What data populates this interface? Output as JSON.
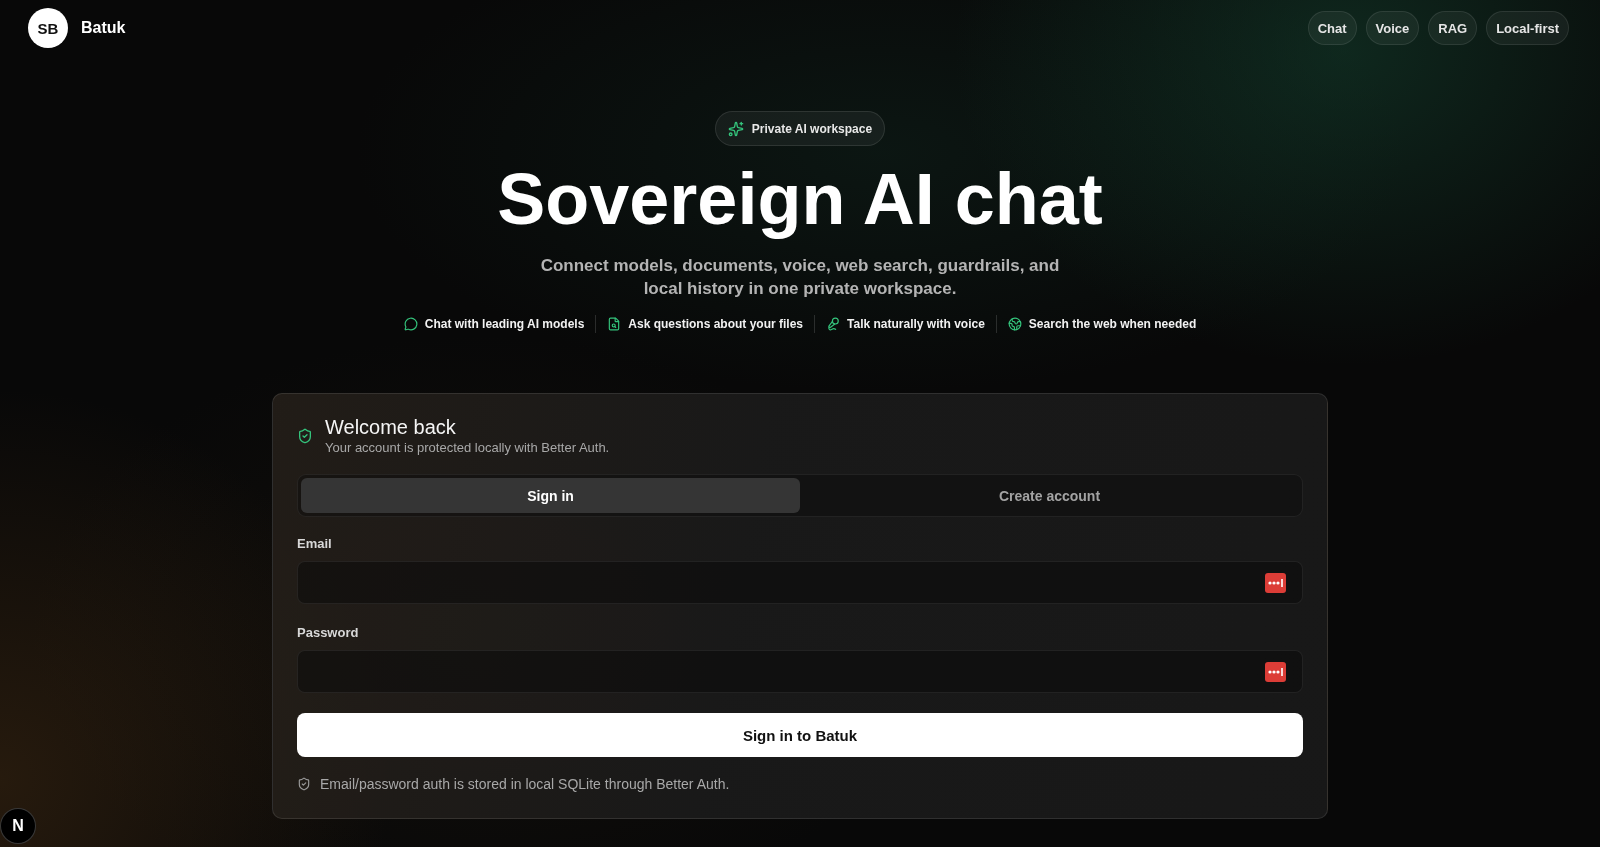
{
  "header": {
    "avatar": "SB",
    "brand": "Batuk",
    "tags": [
      "Chat",
      "Voice",
      "RAG",
      "Local-first"
    ]
  },
  "hero": {
    "badge": "Private AI workspace",
    "title": "Sovereign AI chat",
    "subtitle": "Connect models, documents, voice, web search, guardrails, and local history in one private workspace.",
    "features": [
      {
        "kind": "chat",
        "label": "Chat with leading AI models"
      },
      {
        "kind": "files",
        "label": "Ask questions about your files"
      },
      {
        "kind": "voice",
        "label": "Talk naturally with voice"
      },
      {
        "kind": "web",
        "label": "Search the web when needed"
      }
    ]
  },
  "auth_card": {
    "title": "Welcome back",
    "subtitle": "Your account is protected locally with Better Auth.",
    "tabs": [
      {
        "label": "Sign in",
        "selected": true
      },
      {
        "label": "Create account",
        "selected": false
      }
    ],
    "fields": [
      {
        "label": "Email"
      },
      {
        "label": "Password"
      }
    ],
    "submit": "Sign in to Batuk",
    "note": "Email/password auth is stored in local SQLite through Better Auth."
  },
  "dev_indicator": "N"
}
